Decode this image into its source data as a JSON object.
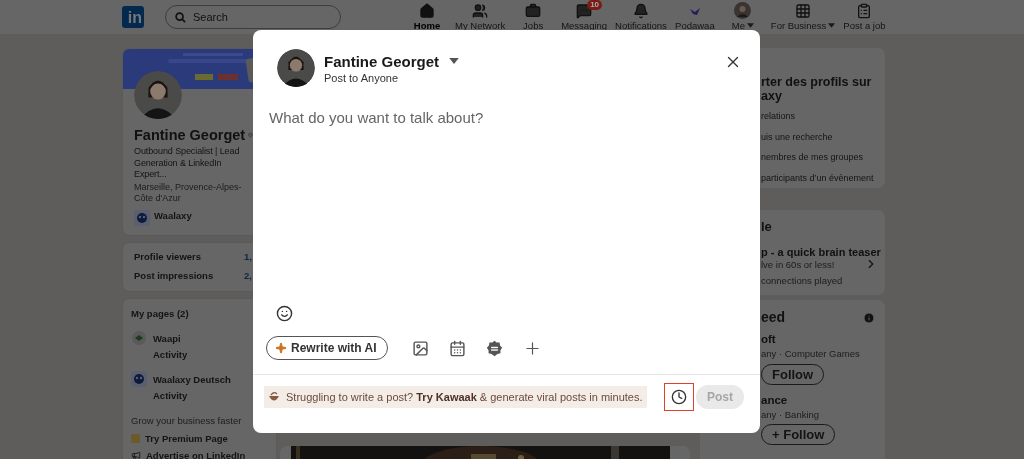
{
  "nav": {
    "logo": "in",
    "search": {
      "placeholder": "Search"
    },
    "items": [
      {
        "label": "Home",
        "selected": true
      },
      {
        "label": "My Network",
        "selected": false
      },
      {
        "label": "Jobs",
        "selected": false
      },
      {
        "label": "Messaging",
        "selected": false,
        "badge": "10"
      },
      {
        "label": "Notifications",
        "selected": false
      },
      {
        "label": "Podawaa",
        "selected": false
      },
      {
        "label": "Me",
        "selected": false,
        "dropdown": true
      },
      {
        "label": "For Business",
        "selected": false,
        "dropdown": true
      },
      {
        "label": "Post a job",
        "selected": false
      }
    ]
  },
  "profile": {
    "name": "Fantine Georget",
    "verified": true,
    "headline": "Outbound Specialist | Lead Generation & LinkedIn Expert...",
    "location": "Marseille, Provence-Alpes-Côte d'Azur",
    "company": "Waalaxy"
  },
  "stats": [
    {
      "label": "Profile viewers",
      "value": "1,"
    },
    {
      "label": "Post impressions",
      "value": "2,"
    }
  ],
  "pages": {
    "title": "My pages (2)",
    "items": [
      {
        "name": "Waapi",
        "activity": "Activity"
      },
      {
        "name": "Waalaxy Deutsch",
        "activity": "Activity"
      }
    ],
    "grow_title": "Grow your business faster",
    "links": [
      "Try Premium Page",
      "Advertise on LinkedIn"
    ]
  },
  "right": {
    "import_card": {
      "title": [
        "rter des profils sur",
        "axy"
      ],
      "items": [
        "relations",
        "uis une recherche",
        "nembres de mes groupes",
        "participants d’un évènement"
      ]
    },
    "puzzle_card": {
      "title": "le",
      "game": "p - a quick brain teaser",
      "subtitle": "lve in 60s or less!",
      "played": "connections played"
    },
    "feed_card": {
      "title": "eed",
      "companies": [
        {
          "name": "oft",
          "meta": "any · Computer Games",
          "follow": "Follow"
        },
        {
          "name": "ance",
          "meta": "any · Banking",
          "follow": "+ Follow"
        }
      ]
    }
  },
  "composer": {
    "author": "Fantine Georget",
    "audience": "Post to Anyone",
    "placeholder": "What do you want to talk about?",
    "rewrite": "Rewrite with AI",
    "promo": "Struggling to write a post? **Try Kawaak** & generate viral posts in minutes.",
    "schedule": {
      "highlighted": true
    },
    "post_button": {
      "label": "Post",
      "disabled": true
    }
  }
}
